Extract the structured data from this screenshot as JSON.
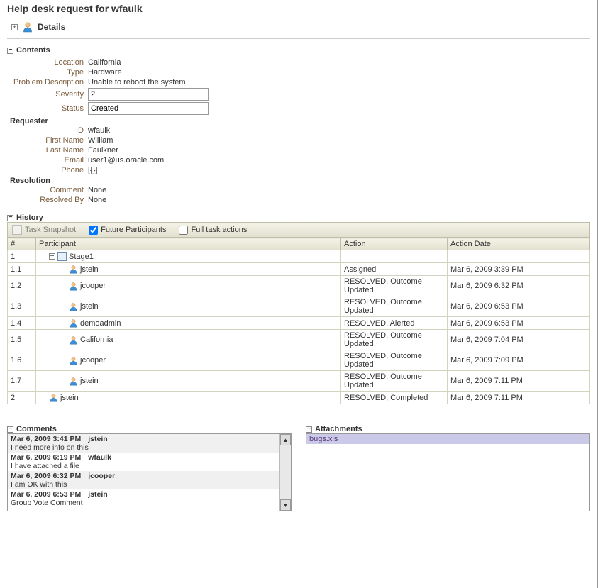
{
  "header": {
    "title": "Help desk request for wfaulk"
  },
  "details": {
    "label": "Details"
  },
  "contents": {
    "title": "Contents",
    "fields": {
      "location": {
        "label": "Location",
        "value": "California"
      },
      "type": {
        "label": "Type",
        "value": "Hardware"
      },
      "problemDescription": {
        "label": "Problem Description",
        "value": "Unable to reboot the system"
      },
      "severity": {
        "label": "Severity",
        "value": "2"
      },
      "status": {
        "label": "Status",
        "value": "Created"
      }
    },
    "requester": {
      "title": "Requester",
      "id": {
        "label": "ID",
        "value": "wfaulk"
      },
      "firstName": {
        "label": "First Name",
        "value": "William"
      },
      "lastName": {
        "label": "Last Name",
        "value": "Faulkner"
      },
      "email": {
        "label": "Email",
        "value": "user1@us.oracle.com"
      },
      "phone": {
        "label": "Phone",
        "value": "[{}]"
      }
    },
    "resolution": {
      "title": "Resolution",
      "comment": {
        "label": "Comment",
        "value": "None"
      },
      "resolvedBy": {
        "label": "Resolved By",
        "value": "None"
      }
    }
  },
  "history": {
    "title": "History",
    "toolbar": {
      "snapshot": "Task Snapshot",
      "future": "Future Participants",
      "full": "Full task actions"
    },
    "columns": {
      "num": "#",
      "participant": "Participant",
      "action": "Action",
      "date": "Action Date"
    },
    "rows": [
      {
        "num": "1",
        "indent": 0,
        "expander": true,
        "stage": true,
        "label": "Stage1",
        "action": "",
        "date": ""
      },
      {
        "num": "1.1",
        "indent": 1,
        "label": "jstein",
        "action": "Assigned",
        "date": "Mar 6, 2009 3:39 PM"
      },
      {
        "num": "1.2",
        "indent": 1,
        "label": "jcooper",
        "action": "RESOLVED, Outcome Updated",
        "date": "Mar 6, 2009 6:32 PM"
      },
      {
        "num": "1.3",
        "indent": 1,
        "label": "jstein",
        "action": "RESOLVED, Outcome Updated",
        "date": "Mar 6, 2009 6:53 PM"
      },
      {
        "num": "1.4",
        "indent": 1,
        "label": "demoadmin",
        "action": "RESOLVED, Alerted",
        "date": "Mar 6, 2009 6:53 PM"
      },
      {
        "num": "1.5",
        "indent": 1,
        "label": "California",
        "action": "RESOLVED, Outcome Updated",
        "date": "Mar 6, 2009 7:04 PM"
      },
      {
        "num": "1.6",
        "indent": 1,
        "label": "jcooper",
        "action": "RESOLVED, Outcome Updated",
        "date": "Mar 6, 2009 7:09 PM"
      },
      {
        "num": "1.7",
        "indent": 1,
        "label": "jstein",
        "action": "RESOLVED, Outcome Updated",
        "date": "Mar 6, 2009 7:11 PM"
      },
      {
        "num": "2",
        "indent": 0,
        "label": "jstein",
        "action": "RESOLVED, Completed",
        "date": "Mar 6, 2009 7:11 PM"
      }
    ]
  },
  "comments": {
    "title": "Comments",
    "items": [
      {
        "ts": "Mar 6, 2009 3:41 PM",
        "author": "jstein",
        "text": "I need more info on this"
      },
      {
        "ts": "Mar 6, 2009 6:19 PM",
        "author": "wfaulk",
        "text": "I have attached a file"
      },
      {
        "ts": "Mar 6, 2009 6:32 PM",
        "author": "jcooper",
        "text": "I am OK with this"
      },
      {
        "ts": "Mar 6, 2009 6:53 PM",
        "author": "jstein",
        "text": "Group Vote Comment"
      }
    ]
  },
  "attachments": {
    "title": "Attachments",
    "items": [
      {
        "name": "bugs.xls"
      }
    ]
  }
}
